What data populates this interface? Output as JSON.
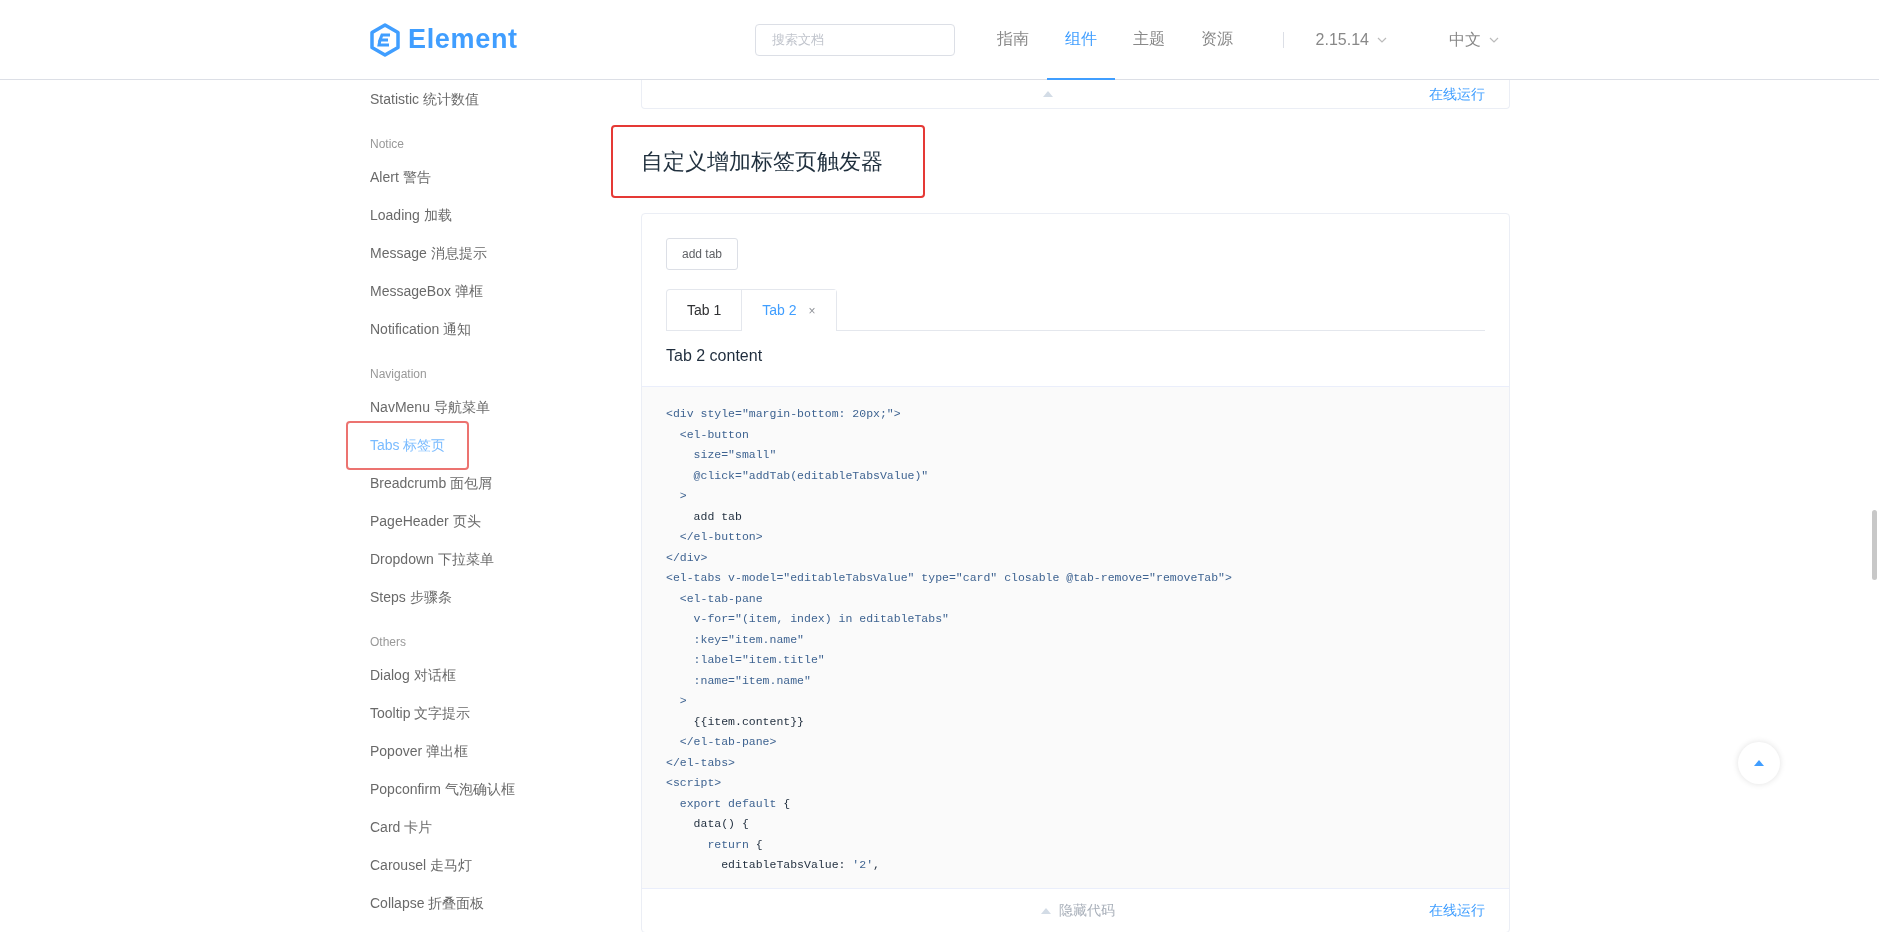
{
  "header": {
    "logo": "Element",
    "search": {
      "placeholder": "搜索文档"
    },
    "nav": [
      {
        "label": "指南",
        "selected": false
      },
      {
        "label": "组件",
        "selected": true
      },
      {
        "label": "主题",
        "selected": false
      },
      {
        "label": "资源",
        "selected": false
      }
    ],
    "version": "2.15.14",
    "language": "中文"
  },
  "sidebar": {
    "groups": [
      {
        "items": [
          {
            "label": "Statistic 统计数值",
            "selected": false,
            "annotated": false
          }
        ]
      },
      {
        "title": "Notice",
        "items": [
          {
            "label": "Alert 警告",
            "selected": false,
            "annotated": false
          },
          {
            "label": "Loading 加载",
            "selected": false,
            "annotated": false
          },
          {
            "label": "Message 消息提示",
            "selected": false,
            "annotated": false
          },
          {
            "label": "MessageBox 弹框",
            "selected": false,
            "annotated": false
          },
          {
            "label": "Notification 通知",
            "selected": false,
            "annotated": false
          }
        ]
      },
      {
        "title": "Navigation",
        "items": [
          {
            "label": "NavMenu 导航菜单",
            "selected": false,
            "annotated": false
          },
          {
            "label": "Tabs 标签页",
            "selected": true,
            "annotated": true
          },
          {
            "label": "Breadcrumb 面包屑",
            "selected": false,
            "annotated": false
          },
          {
            "label": "PageHeader 页头",
            "selected": false,
            "annotated": false
          },
          {
            "label": "Dropdown 下拉菜单",
            "selected": false,
            "annotated": false
          },
          {
            "label": "Steps 步骤条",
            "selected": false,
            "annotated": false
          }
        ]
      },
      {
        "title": "Others",
        "items": [
          {
            "label": "Dialog 对话框",
            "selected": false,
            "annotated": false
          },
          {
            "label": "Tooltip 文字提示",
            "selected": false,
            "annotated": false
          },
          {
            "label": "Popover 弹出框",
            "selected": false,
            "annotated": false
          },
          {
            "label": "Popconfirm 气泡确认框",
            "selected": false,
            "annotated": false
          },
          {
            "label": "Card 卡片",
            "selected": false,
            "annotated": false
          },
          {
            "label": "Carousel 走马灯",
            "selected": false,
            "annotated": false
          },
          {
            "label": "Collapse 折叠面板",
            "selected": false,
            "annotated": false
          }
        ]
      }
    ]
  },
  "previous_demo": {
    "run_link": "在线运行"
  },
  "section": {
    "title": "自定义增加标签页触发器",
    "annotated": true
  },
  "demo": {
    "button": "add tab",
    "tabs": [
      {
        "label": "Tab 1",
        "selected": false,
        "closable": false
      },
      {
        "label": "Tab 2",
        "selected": true,
        "closable": true,
        "close": "×"
      }
    ],
    "content": "Tab 2 content",
    "code": [
      [
        {
          "kind": "tag",
          "text": "<div style=\"margin-bottom: 20px;\">"
        }
      ],
      [
        {
          "kind": "tag",
          "text": "  <el-button"
        }
      ],
      [
        {
          "kind": "tag",
          "text": "    size=\"small\""
        }
      ],
      [
        {
          "kind": "tag",
          "text": "    @click=\"addTab(editableTabsValue)\""
        }
      ],
      [
        {
          "kind": "tag",
          "text": "  >"
        }
      ],
      [
        {
          "kind": "plain",
          "text": "    add tab"
        }
      ],
      [
        {
          "kind": "tag",
          "text": "  </el-button>"
        }
      ],
      [
        {
          "kind": "tag",
          "text": "</div>"
        }
      ],
      [
        {
          "kind": "tag",
          "text": "<el-tabs v-model=\"editableTabsValue\" type=\"card\" closable @tab-remove=\"removeTab\">"
        }
      ],
      [
        {
          "kind": "tag",
          "text": "  <el-tab-pane"
        }
      ],
      [
        {
          "kind": "tag",
          "text": "    v-for=\"(item, index) in editableTabs\""
        }
      ],
      [
        {
          "kind": "tag",
          "text": "    :key=\"item.name\""
        }
      ],
      [
        {
          "kind": "tag",
          "text": "    :label=\"item.title\""
        }
      ],
      [
        {
          "kind": "tag",
          "text": "    :name=\"item.name\""
        }
      ],
      [
        {
          "kind": "tag",
          "text": "  >"
        }
      ],
      [
        {
          "kind": "plain",
          "text": "    {{item.content}}"
        }
      ],
      [
        {
          "kind": "tag",
          "text": "  </el-tab-pane>"
        }
      ],
      [
        {
          "kind": "tag",
          "text": "</el-tabs>"
        }
      ],
      [
        {
          "kind": "tag",
          "text": "<script>"
        }
      ],
      [
        {
          "kind": "tag",
          "text": "  export default "
        },
        {
          "kind": "plain",
          "text": "{"
        }
      ],
      [
        {
          "kind": "plain",
          "text": "    data() {"
        }
      ],
      [
        {
          "kind": "tag",
          "text": "      return "
        },
        {
          "kind": "plain",
          "text": "{"
        }
      ],
      [
        {
          "kind": "plain",
          "text": "        editableTabsValue: "
        },
        {
          "kind": "tag",
          "text": "'2'"
        },
        {
          "kind": "plain",
          "text": ","
        }
      ]
    ],
    "hide_code": "隐藏代码",
    "run_link": "在线运行"
  }
}
